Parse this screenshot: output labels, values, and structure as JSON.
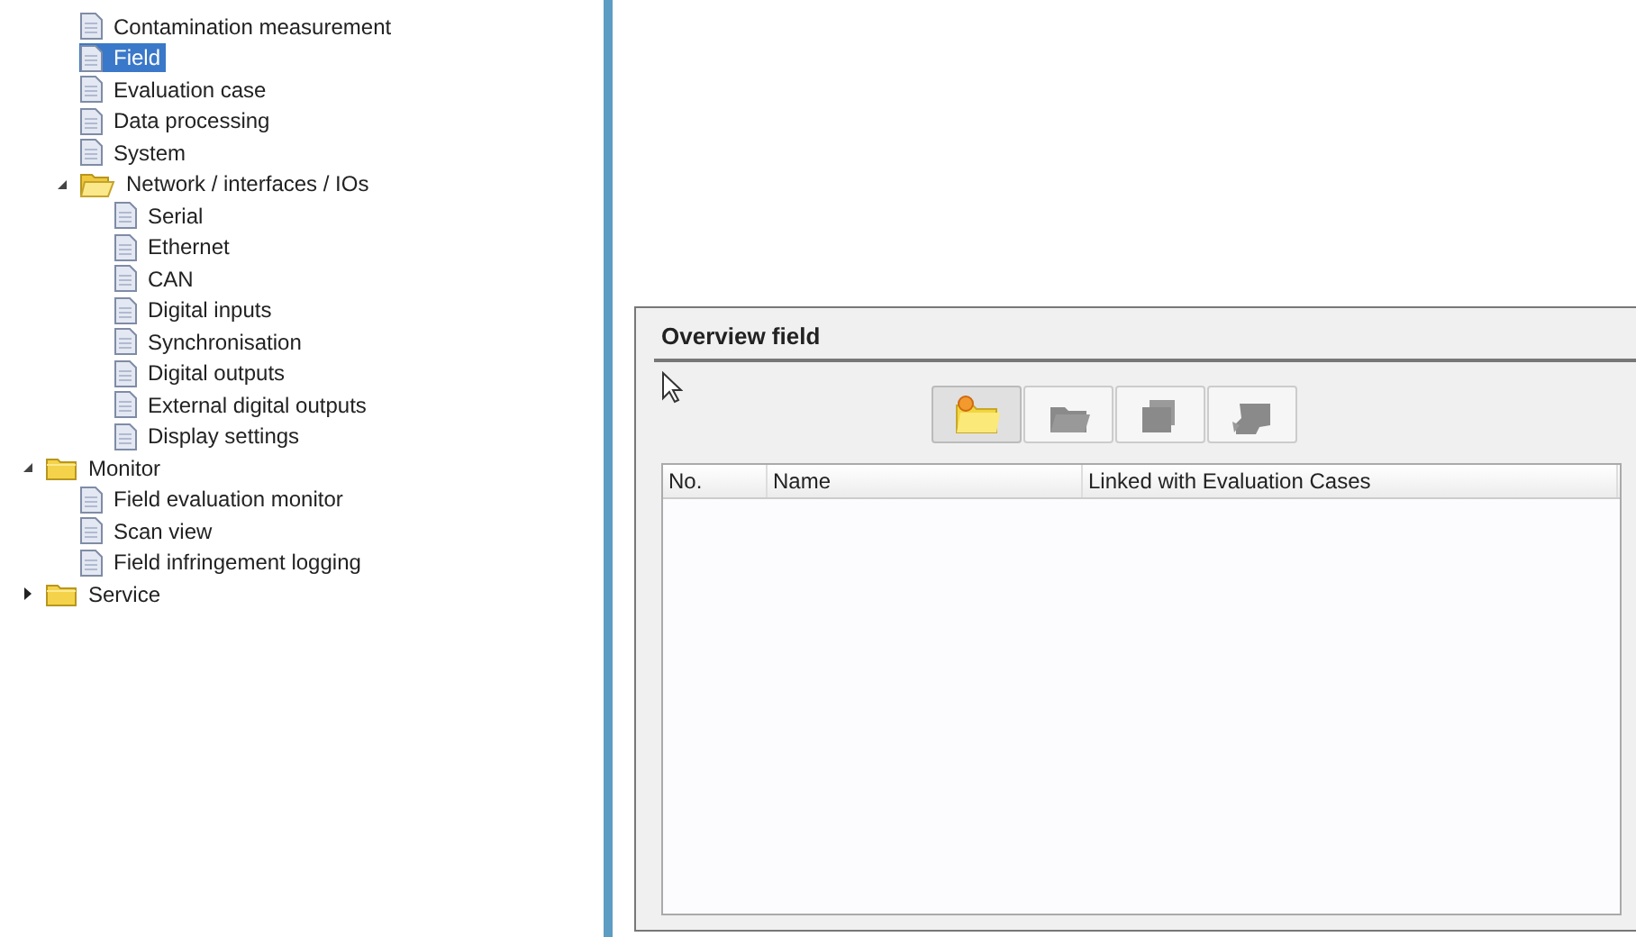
{
  "tree": {
    "continued_items": [
      {
        "label": "Contamination measurement",
        "kind": "page",
        "selected": false
      },
      {
        "label": "Field",
        "kind": "page",
        "selected": true
      },
      {
        "label": "Evaluation case",
        "kind": "page",
        "selected": false
      },
      {
        "label": "Data processing",
        "kind": "page",
        "selected": false
      },
      {
        "label": "System",
        "kind": "page",
        "selected": false
      },
      {
        "label": "Network / interfaces / IOs",
        "kind": "open-folder",
        "selected": false,
        "expanded": true,
        "children": [
          {
            "label": "Serial",
            "kind": "page",
            "selected": false
          },
          {
            "label": "Ethernet",
            "kind": "page",
            "selected": false
          },
          {
            "label": "CAN",
            "kind": "page",
            "selected": false
          },
          {
            "label": "Digital inputs",
            "kind": "page",
            "selected": false
          },
          {
            "label": "Synchronisation",
            "kind": "page",
            "selected": false
          },
          {
            "label": "Digital outputs",
            "kind": "page",
            "selected": false
          },
          {
            "label": "External digital outputs",
            "kind": "page",
            "selected": false
          },
          {
            "label": "Display settings",
            "kind": "page",
            "selected": false
          }
        ]
      }
    ],
    "items": [
      {
        "label": "Monitor",
        "kind": "folder",
        "selected": false,
        "expanded": true,
        "children": [
          {
            "label": "Field evaluation monitor",
            "kind": "page",
            "selected": false
          },
          {
            "label": "Scan view",
            "kind": "page",
            "selected": false
          },
          {
            "label": "Field infringement logging",
            "kind": "page",
            "selected": false
          }
        ]
      },
      {
        "label": "Service",
        "kind": "folder",
        "selected": false,
        "expanded": false
      }
    ]
  },
  "panel": {
    "title": "Overview field",
    "toolbar": [
      {
        "kind": "add",
        "disabled": false
      },
      {
        "kind": "open",
        "disabled": true
      },
      {
        "kind": "stack",
        "disabled": true
      },
      {
        "kind": "broken",
        "disabled": true
      }
    ],
    "table": {
      "columns": [
        "No.",
        "Name",
        "Linked with Evaluation Cases"
      ]
    }
  }
}
